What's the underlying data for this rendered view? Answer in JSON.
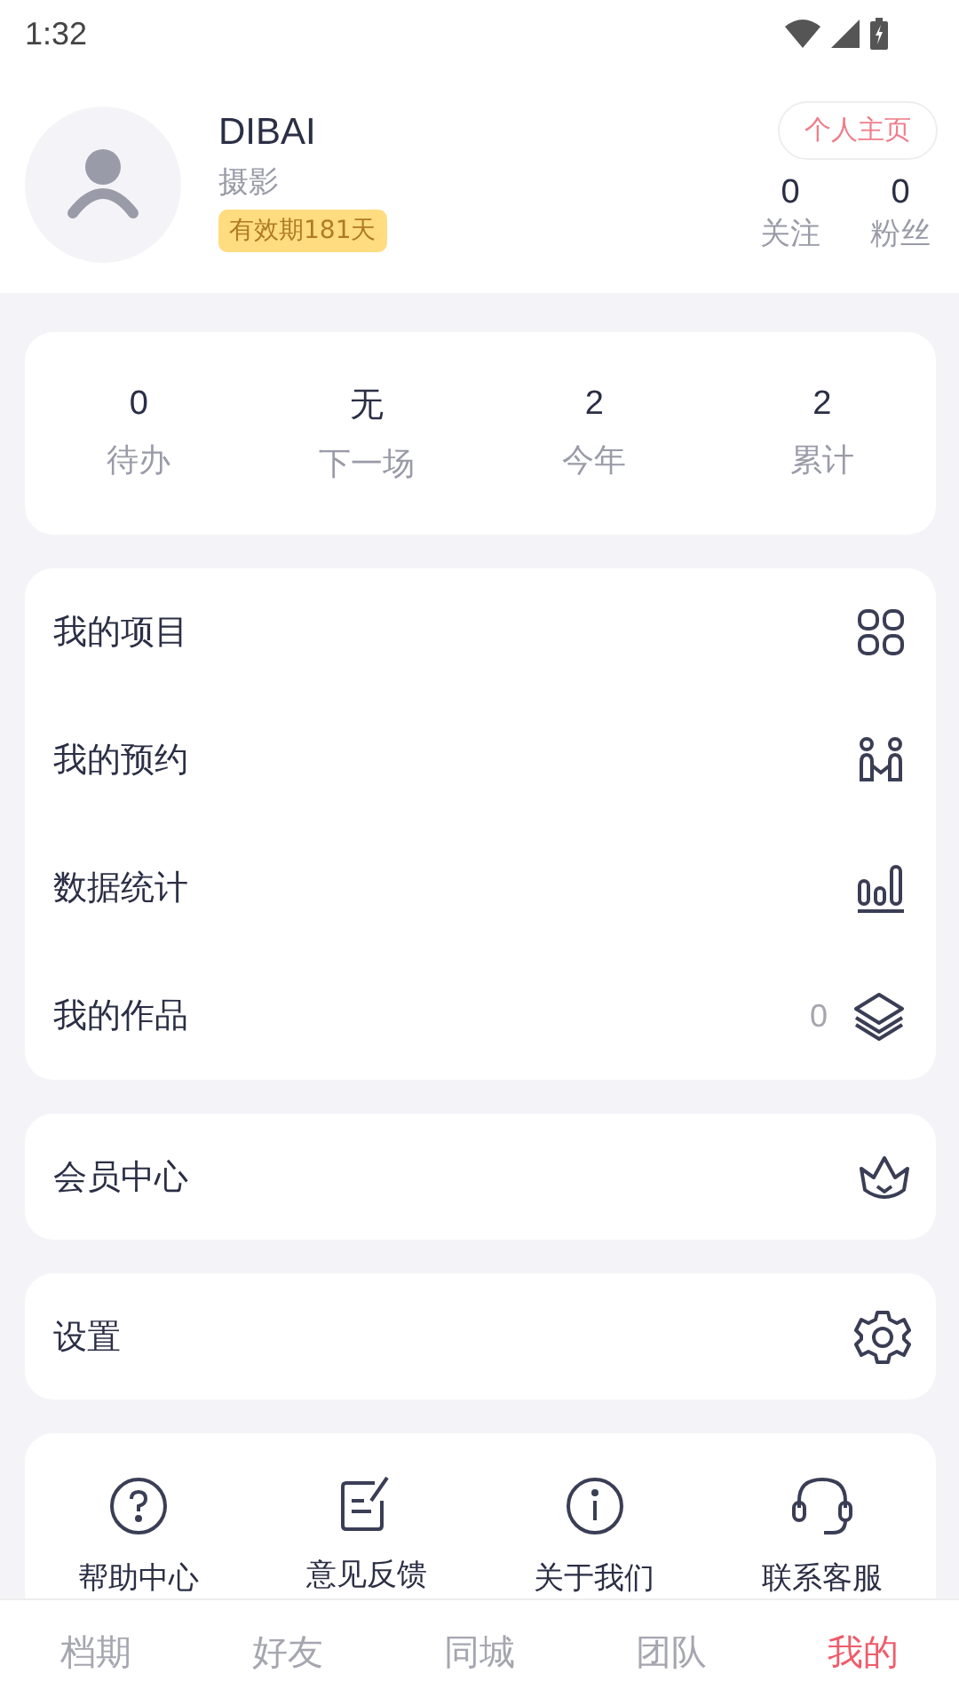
{
  "status_bar": {
    "time": "1:32"
  },
  "profile": {
    "name": "DIBAI",
    "role": "摄影",
    "validity": "有效期181天",
    "homepage_button": "个人主页",
    "stats": [
      {
        "value": "0",
        "label": "关注"
      },
      {
        "value": "0",
        "label": "粉丝"
      }
    ]
  },
  "summary": [
    {
      "value": "0",
      "label": "待办"
    },
    {
      "value": "无",
      "label": "下一场"
    },
    {
      "value": "2",
      "label": "今年"
    },
    {
      "value": "2",
      "label": "累计"
    }
  ],
  "menu": [
    {
      "label": "我的项目"
    },
    {
      "label": "我的预约"
    },
    {
      "label": "数据统计"
    },
    {
      "label": "我的作品",
      "count": "0"
    }
  ],
  "member_row": {
    "label": "会员中心"
  },
  "settings_row": {
    "label": "设置"
  },
  "services": [
    {
      "label": "帮助中心"
    },
    {
      "label": "意见反馈"
    },
    {
      "label": "关于我们"
    },
    {
      "label": "联系客服"
    }
  ],
  "tabs": [
    {
      "label": "档期",
      "selected": false
    },
    {
      "label": "好友",
      "selected": false
    },
    {
      "label": "同城",
      "selected": false
    },
    {
      "label": "团队",
      "selected": false
    },
    {
      "label": "我的",
      "selected": true
    }
  ]
}
